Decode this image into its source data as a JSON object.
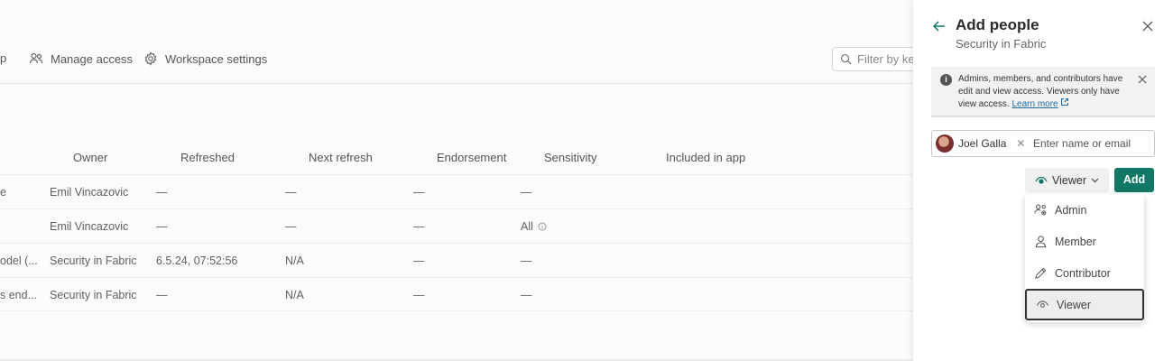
{
  "toolbar": {
    "truncated_item": "p",
    "manage_access": "Manage access",
    "workspace_settings": "Workspace settings",
    "filter_placeholder": "Filter by key"
  },
  "table": {
    "headers": [
      "Owner",
      "Refreshed",
      "Next refresh",
      "Endorsement",
      "Sensitivity",
      "Included in app"
    ],
    "rows": [
      {
        "name": "e",
        "owner": "Emil Vincazovic",
        "refreshed": "—",
        "next": "—",
        "endorsement": "—",
        "sensitivity": "—"
      },
      {
        "name": "",
        "owner": "Emil Vincazovic",
        "refreshed": "—",
        "next": "—",
        "endorsement": "—",
        "sensitivity": "All"
      },
      {
        "name": "odel (...",
        "owner": "Security in Fabric",
        "refreshed": "6.5.24, 07:52:56",
        "next": "N/A",
        "endorsement": "—",
        "sensitivity": "—"
      },
      {
        "name": "s end...",
        "owner": "Security in Fabric",
        "refreshed": "—",
        "next": "N/A",
        "endorsement": "—",
        "sensitivity": "—"
      }
    ]
  },
  "panel": {
    "title": "Add people",
    "subtitle": "Security in Fabric",
    "info_text": "Admins, members, and contributors have edit and view access. Viewers only have view access.",
    "learn_more": "Learn more",
    "chip_name": "Joel Galla",
    "name_placeholder": "Enter name or email",
    "selected_role": "Viewer",
    "add_label": "Add",
    "roles": [
      "Admin",
      "Member",
      "Contributor",
      "Viewer"
    ]
  },
  "colors": {
    "accent": "#117865",
    "link": "#1d6aa7"
  }
}
